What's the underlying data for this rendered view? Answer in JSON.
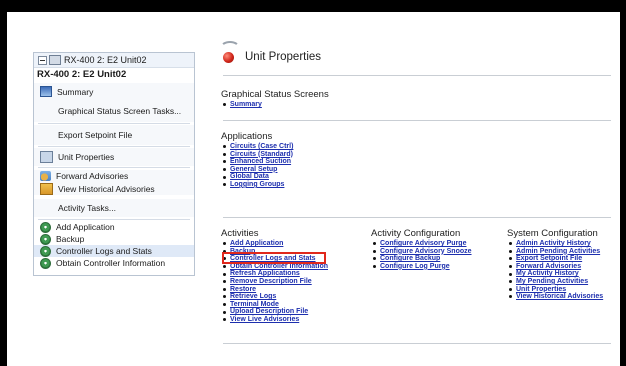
{
  "left_panel": {
    "tree_node": "RX-400 2: E2 Unit02",
    "selected_title": "RX-400 2: E2 Unit02",
    "items": {
      "summary": "Summary",
      "graphical_tasks": "Graphical Status Screen Tasks...",
      "export_setpoint": "Export Setpoint File",
      "unit_properties": "Unit Properties",
      "forward_advisories": "Forward Advisories",
      "view_historical": "View Historical Advisories",
      "activity_tasks": "Activity Tasks..."
    },
    "actions": [
      "Add Application",
      "Backup",
      "Controller Logs and Stats",
      "Obtain Controller Information"
    ]
  },
  "right_panel": {
    "title": "Unit Properties",
    "graphical": {
      "heading": "Graphical Status Screens",
      "links": [
        "Summary"
      ]
    },
    "applications": {
      "heading": "Applications",
      "links": [
        "Circuits (Case Ctrl)",
        "Circuits (Standard)",
        "Enhanced Suction",
        "General Setup",
        "Global Data",
        "Logging Groups"
      ]
    },
    "activities": {
      "heading": "Activities",
      "links": [
        "Add Application",
        "Backup",
        "Controller Logs and Stats",
        "Obtain Controller Information",
        "Refresh Applications",
        "Remove Description File",
        "Restore",
        "Retrieve Logs",
        "Terminal Mode",
        "Upload Description File",
        "View Live Advisories"
      ]
    },
    "activity_configuration": {
      "heading": "Activity Configuration",
      "links": [
        "Configure Advisory Purge",
        "Configure Advisory Snooze",
        "Configure Backup",
        "Configure Log Purge"
      ]
    },
    "system_configuration": {
      "heading": "System Configuration",
      "links": [
        "Admin Activity History",
        "Admin Pending Activities",
        "Export Setpoint File",
        "Forward Advisories",
        "My Activity History",
        "My Pending Activities",
        "Unit Properties",
        "View Historical Advisories"
      ]
    }
  },
  "colors": {
    "link": "#1d2fae",
    "highlight_box": "#e0281c"
  }
}
